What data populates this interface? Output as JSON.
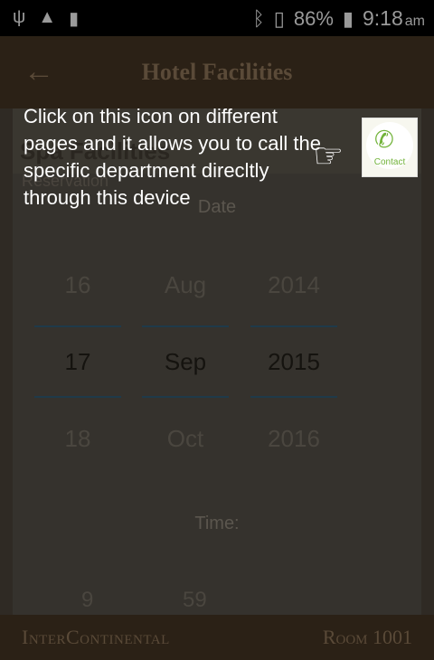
{
  "status_bar": {
    "left_icons": [
      "usb-icon",
      "warning-icon",
      "sim-icon"
    ],
    "bluetooth_icon": "bluetooth-icon",
    "vibrate_icon": "vibrate-icon",
    "battery": "86%",
    "battery_icon": "battery-charging-icon",
    "time": "9:18",
    "ampm": "am"
  },
  "app_bar": {
    "back_glyph": "←",
    "title": "Hotel Facilities"
  },
  "section": {
    "title": "Spa Facilities",
    "subtitle": "Reservation"
  },
  "date_picker": {
    "label": "Date",
    "day": {
      "prev": "16",
      "current": "17",
      "next": "18"
    },
    "month": {
      "prev": "Aug",
      "current": "Sep",
      "next": "Oct"
    },
    "year": {
      "prev": "2014",
      "current": "2015",
      "next": "2016"
    }
  },
  "time_picker": {
    "label": "Time:",
    "hour": "9",
    "minute": "59"
  },
  "footer": {
    "brand": "InterContinental",
    "room": "Room 1001"
  },
  "tooltip": {
    "text": "Click on this icon on different pages and it allows you to call the specific department direcltly through this device",
    "pointer_icon": "hand-pointing-icon",
    "hand_glyph": "☞"
  },
  "contact_button": {
    "label": "Contact",
    "icon": "phone-icon",
    "glyph": "✆"
  },
  "colors": {
    "accent_green": "#72b33a",
    "overlay": "#000000"
  }
}
